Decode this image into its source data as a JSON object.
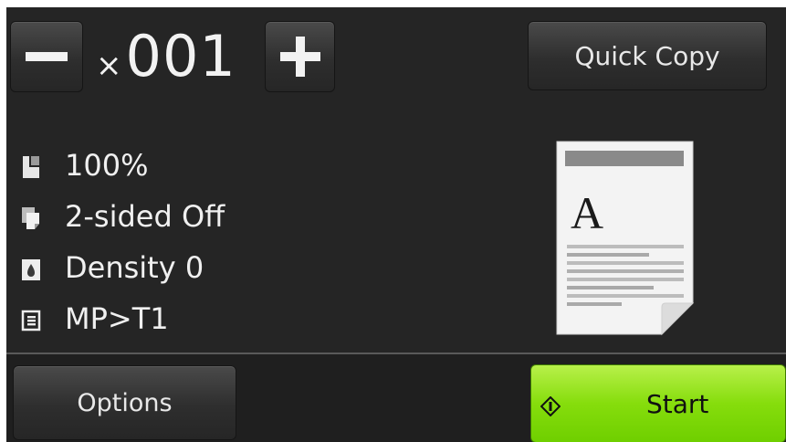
{
  "copy_count": {
    "prefix": "×",
    "value": "001"
  },
  "buttons": {
    "quick_copy": "Quick Copy",
    "options": "Options",
    "start": "Start"
  },
  "settings": [
    {
      "icon": "page-enlarge-icon",
      "label": "100%"
    },
    {
      "icon": "two-sided-icon",
      "label": "2-sided Off"
    },
    {
      "icon": "density-drop-icon",
      "label": "Density 0"
    },
    {
      "icon": "tray-list-icon",
      "label": "MP>T1"
    }
  ],
  "preview": {
    "letter": "A"
  },
  "colors": {
    "background": "#252525",
    "start_green": "#86dd0c",
    "text": "#f0f0f0"
  }
}
